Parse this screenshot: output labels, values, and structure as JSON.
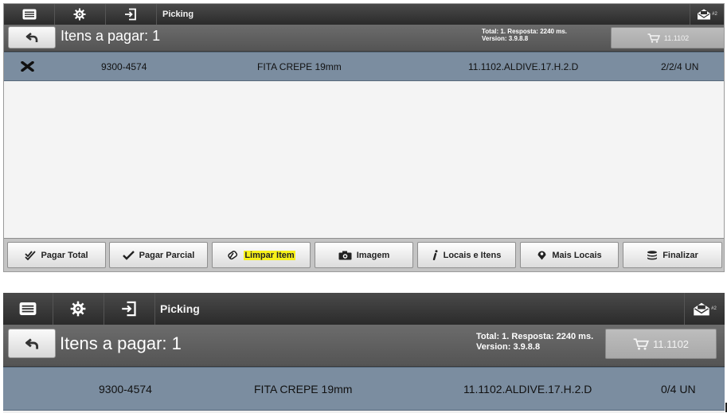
{
  "app": {
    "title": "Picking",
    "icons": [
      "menu-icon",
      "gear-icon",
      "login-icon",
      "mail-icon"
    ],
    "mail_badge": "#2"
  },
  "header": {
    "back_icon": "undo-arrow-icon",
    "items_title": "Itens a pagar: 1",
    "stats_line1": "Total: 1. Resposta: 2240 ms.",
    "stats_line2": "Version: 3.9.8.8",
    "cart_icon": "cart-icon",
    "cart_label": "11.1102"
  },
  "item_row_top": {
    "status_icon": "x-icon",
    "code": "9300-4574",
    "description": "FITA CREPE 19mm",
    "location": "11.1102.ALDIVE.17.H.2.D",
    "quantity": "2/2/4 UN"
  },
  "item_row_bottom": {
    "code": "9300-4574",
    "description": "FITA CREPE 19mm",
    "location": "11.1102.ALDIVE.17.H.2.D",
    "quantity": "0/4 UN"
  },
  "footer": {
    "pagar_total": "Pagar Total",
    "pagar_parcial": "Pagar Parcial",
    "limpar_item": "Limpar Item",
    "imagem": "Imagem",
    "locais_itens": "Locais e Itens",
    "mais_locais": "Mais Locais",
    "finalizar": "Finalizar"
  },
  "colors": {
    "topbar": "#2f2f2f",
    "header": "#5e5e5e",
    "row": "#7b8da0",
    "highlight": "#f6f01a"
  }
}
